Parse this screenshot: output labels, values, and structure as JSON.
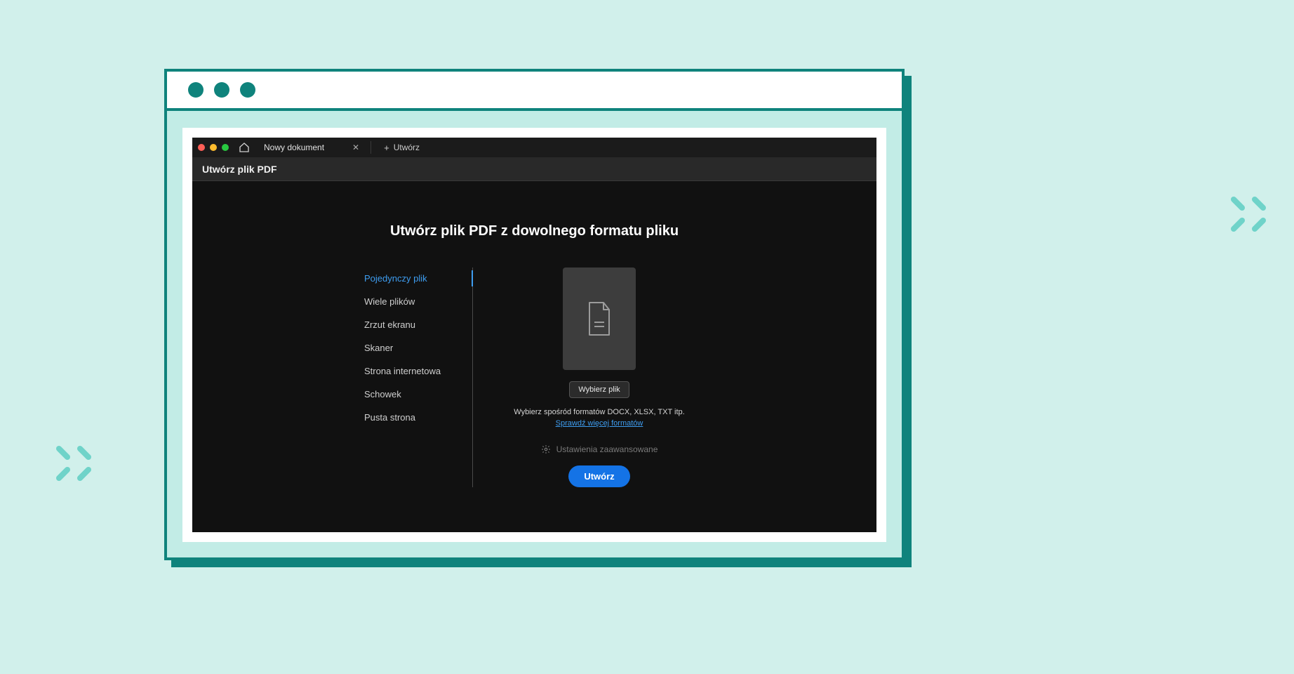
{
  "decoColor": "#6fd3c9",
  "tabbar": {
    "docTabLabel": "Nowy dokument",
    "newTabLabel": "Utwórz"
  },
  "toolbar": {
    "title": "Utwórz plik PDF"
  },
  "main": {
    "heading": "Utwórz plik PDF z dowolnego formatu pliku",
    "sources": [
      "Pojedynczy plik",
      "Wiele plików",
      "Zrzut ekranu",
      "Skaner",
      "Strona internetowa",
      "Schowek",
      "Pusta strona"
    ],
    "activeSourceIndex": 0,
    "selectFileLabel": "Wybierz plik",
    "hint": "Wybierz spośród formatów DOCX, XLSX, TXT itp.",
    "moreFormatsLabel": "Sprawdź więcej formatów",
    "advancedLabel": "Ustawienia zaawansowane",
    "createLabel": "Utwórz"
  }
}
